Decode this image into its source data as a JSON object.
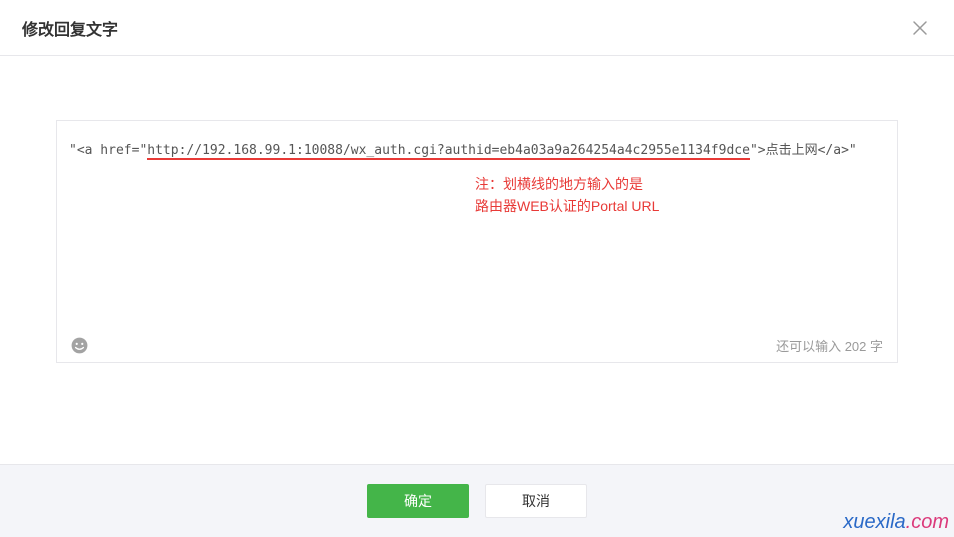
{
  "header": {
    "title": "修改回复文字"
  },
  "editor": {
    "prefix": "\"<a href=\"",
    "url": "http://192.168.99.1:10088/wx_auth.cgi?authid=eb4a03a9a264254a4c2955e1134f9dce",
    "suffix": "\">点击上网</a>\"",
    "annotation_line1": "注：划横线的地方输入的是",
    "annotation_line2": "路由器WEB认证的Portal URL",
    "counter": "还可以输入 202 字"
  },
  "footer": {
    "ok": "确定",
    "cancel": "取消"
  },
  "watermark": {
    "part1": "xuexila",
    "part2": ".com"
  }
}
